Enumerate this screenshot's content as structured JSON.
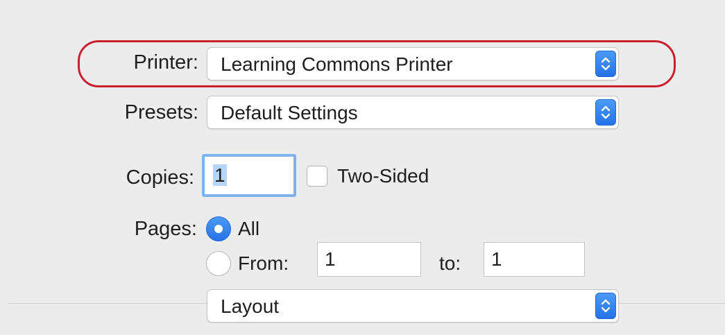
{
  "printer": {
    "label": "Printer:",
    "value": "Learning Commons Printer"
  },
  "presets": {
    "label": "Presets:",
    "value": "Default Settings"
  },
  "copies": {
    "label": "Copies:",
    "value": "1"
  },
  "two_sided": {
    "label": "Two-Sided",
    "checked": false
  },
  "pages": {
    "label": "Pages:",
    "all_label": "All",
    "from_label": "From:",
    "from_value": "1",
    "to_label": "to:",
    "to_value": "1",
    "selected": "All"
  },
  "section_menu": {
    "value": "Layout"
  },
  "colors": {
    "accent": "#2f80ed",
    "highlight_ring": "#c8202e",
    "background": "#ececec"
  }
}
